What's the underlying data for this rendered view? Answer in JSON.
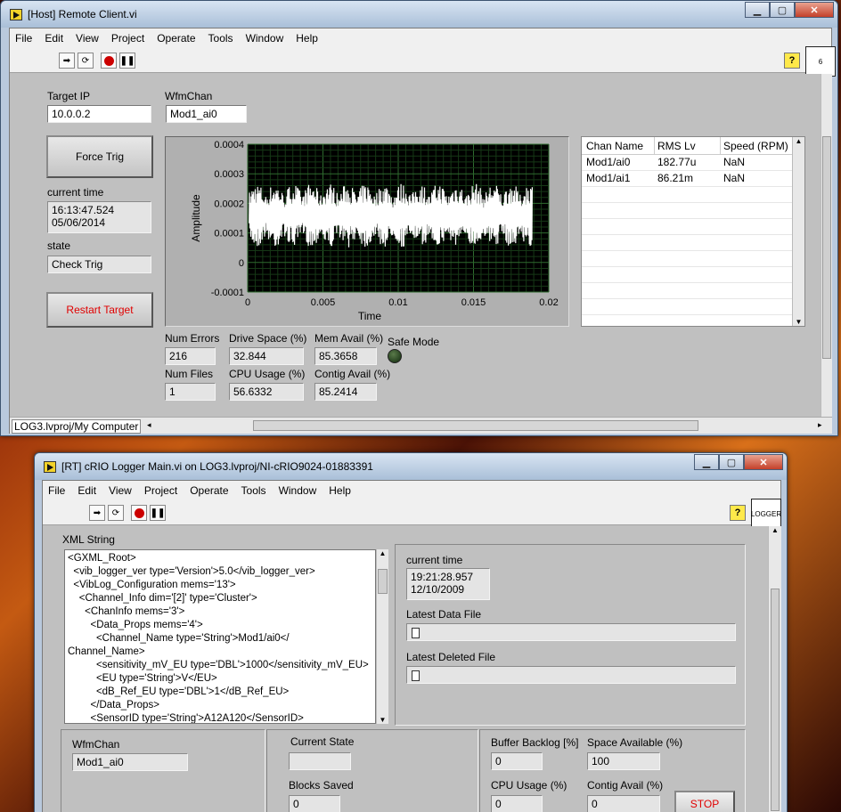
{
  "host": {
    "title": "[Host] Remote Client.vi",
    "menu": [
      "File",
      "Edit",
      "View",
      "Project",
      "Operate",
      "Tools",
      "Window",
      "Help"
    ],
    "target_ip_label": "Target IP",
    "target_ip": "10.0.0.2",
    "wfmchan_label": "WfmChan",
    "wfmchan": "Mod1_ai0",
    "force_trig": "Force Trig",
    "current_time_label": "current time",
    "current_time_1": "16:13:47.524",
    "current_time_2": "05/06/2014",
    "state_label": "state",
    "state": "Check Trig",
    "restart_target": "Restart Target",
    "table_headers": [
      "Chan Name",
      "RMS Lv",
      "Speed (RPM)"
    ],
    "table_rows": [
      [
        "Mod1/ai0",
        "182.77u",
        "NaN"
      ],
      [
        "Mod1/ai1",
        "86.21m",
        "NaN"
      ]
    ],
    "num_errors_label": "Num Errors",
    "num_errors": "216",
    "drive_space_label": "Drive Space (%)",
    "drive_space": "32.844",
    "mem_avail_label": "Mem Avail (%)",
    "mem_avail": "85.3658",
    "safe_mode_label": "Safe Mode",
    "num_files_label": "Num Files",
    "num_files": "1",
    "cpu_usage_label": "CPU Usage (%)",
    "cpu_usage": "56.6332",
    "contig_avail_label": "Contig Avail (%)",
    "contig_avail": "85.2414",
    "status_path": "LOG3.lvproj/My Computer",
    "vi_icon_text": "6"
  },
  "chart_data": {
    "type": "line",
    "xlabel": "Time",
    "ylabel": "Amplitude",
    "xlim": [
      0,
      0.02
    ],
    "ylim": [
      -0.0001,
      0.0004
    ],
    "x_ticks": [
      "0",
      "0.005",
      "0.01",
      "0.015",
      "0.02"
    ],
    "y_ticks": [
      "0.0004",
      "0.0003",
      "0.0002",
      "0.0001",
      "0",
      "-0.0001"
    ],
    "grid": true,
    "series": [
      {
        "color": "#ffffff",
        "mean": 0.00016,
        "amplitude": 0.00011
      }
    ]
  },
  "rt": {
    "title": "[RT] cRIO Logger Main.vi on LOG3.lvproj/NI-cRIO9024-01883391",
    "menu": [
      "File",
      "Edit",
      "View",
      "Project",
      "Operate",
      "Tools",
      "Window",
      "Help"
    ],
    "vi_icon_text": "LOGGER",
    "xml_label": "XML String",
    "xml_lines": [
      "<GXML_Root>",
      "  <vib_logger_ver type='Version'>5.0</vib_logger_ver>",
      "  <VibLog_Configuration mems='13'>",
      "    <Channel_Info dim='[2]' type='Cluster'>",
      "      <ChanInfo mems='3'>",
      "        <Data_Props mems='4'>",
      "          <Channel_Name type='String'>Mod1/ai0</",
      "Channel_Name>",
      "          <sensitivity_mV_EU type='DBL'>1000</sensitivity_mV_EU>",
      "          <EU type='String'>V</EU>",
      "          <dB_Ref_EU type='DBL'>1</dB_Ref_EU>",
      "        </Data_Props>",
      "        <SensorID type='String'>A12A120</SensorID>"
    ],
    "current_time_label": "current time",
    "current_time_1": "19:21:28.957",
    "current_time_2": "12/10/2009",
    "latest_data_file_label": "Latest Data File",
    "latest_deleted_file_label": "Latest Deleted File",
    "wfmchan_label": "WfmChan",
    "wfmchan": "Mod1_ai0",
    "current_state_label": "Current State",
    "current_state": "",
    "blocks_saved_label": "Blocks Saved",
    "blocks_saved": "0",
    "buffer_backlog_label": "Buffer Backlog [%]",
    "buffer_backlog": "0",
    "space_available_label": "Space Available (%)",
    "space_available": "100",
    "cpu_usage_label": "CPU Usage (%)",
    "cpu_usage": "0",
    "contig_avail_label": "Contig Avail (%)",
    "contig_avail": "0",
    "stop": "STOP"
  }
}
